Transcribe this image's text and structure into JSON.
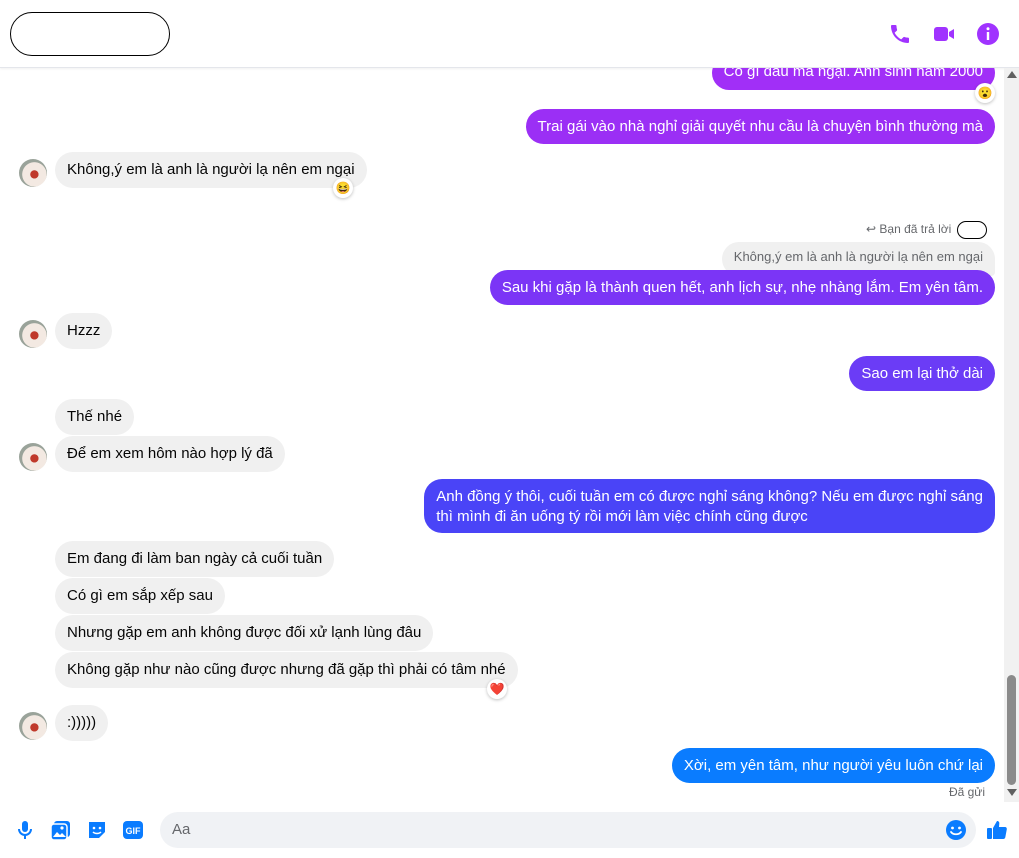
{
  "header": {
    "icons": [
      "phone-icon",
      "video-icon",
      "info-icon"
    ]
  },
  "colors": {
    "accent": "#a033ff",
    "incoming_bubble": "#f0f0f0",
    "blue": "#0a7cff"
  },
  "messages": {
    "m1": "Có gì đâu mà ngại. Anh sinh năm 2000",
    "m1_reaction": "😮",
    "m2": "Trai gái vào nhà nghỉ giải quyết nhu cầu là chuyện bình thường mà",
    "m3": "Không,ý em là anh là người lạ nên em ngại",
    "m3_reaction": "😆",
    "reply_label": "Bạn đã trả lời",
    "quoted": "Không,ý em là anh là người lạ nên em ngại",
    "m4": "Sau khi gặp là thành quen hết, anh lịch sự, nhẹ nhàng lắm. Em yên tâm.",
    "m5": "Hzzz",
    "m6": "Sao em lại thở dài",
    "m7": "Thế nhé",
    "m8": "Để em xem hôm nào hợp lý đã",
    "m9_line1": "Anh đồng ý thôi, cuối tuần em có được nghỉ sáng không? Nếu em được nghỉ sáng",
    "m9_line2": "thì mình đi ăn uống tý rồi mới làm việc chính cũng được",
    "m10": "Em đang đi làm ban ngày cả cuối tuần",
    "m11": "Có gì em sắp xếp sau",
    "m12": "Nhưng gặp em anh không được đối xử lạnh lùng đâu",
    "m13": "Không gặp như nào cũng được nhưng đã gặp thì phải có tâm nhé",
    "m13_reaction": "❤️",
    "m14": ":)))))",
    "m15": "Xời, em yên tâm, như người yêu luôn chứ lại",
    "status": "Đã gửi"
  },
  "composer": {
    "placeholder": "Aa",
    "icons": [
      "microphone-icon",
      "image-icon",
      "sticker-icon",
      "gif-icon",
      "emoji-icon",
      "like-icon"
    ],
    "gif_label": "GIF"
  }
}
